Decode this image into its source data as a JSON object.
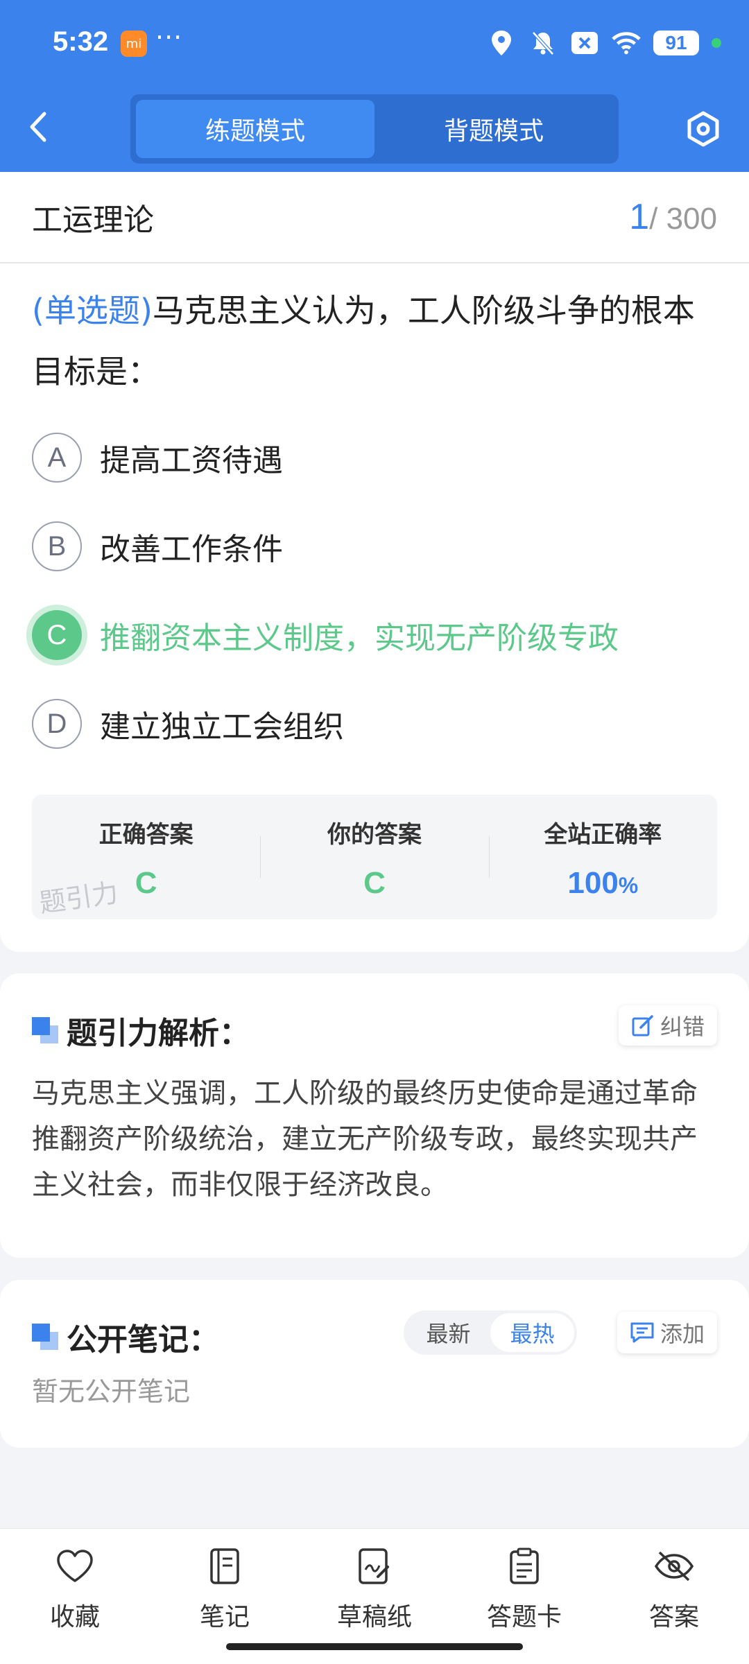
{
  "status_bar": {
    "time": "5:32",
    "app_badge": "mi",
    "more": "···",
    "battery": "91",
    "icons": [
      "location-icon",
      "bell-off-icon",
      "notification-x-icon",
      "wifi-icon"
    ]
  },
  "header": {
    "mode_tabs": [
      "练题模式",
      "背题模式"
    ],
    "active_mode": "练题模式"
  },
  "question": {
    "subject": "工运理论",
    "current": "1",
    "total": "/ 300",
    "type_label": "(单选题)",
    "text": "马克思主义认为，工人阶级斗争的根本目标是：",
    "options": [
      {
        "letter": "A",
        "text": "提高工资待遇"
      },
      {
        "letter": "B",
        "text": "改善工作条件"
      },
      {
        "letter": "C",
        "text": "推翻资本主义制度，实现无产阶级专政"
      },
      {
        "letter": "D",
        "text": "建立独立工会组织"
      }
    ]
  },
  "result": {
    "correct_label": "正确答案",
    "correct_value": "C",
    "yours_label": "你的答案",
    "yours_value": "C",
    "rate_label": "全站正确率",
    "rate_value": "100",
    "rate_unit": "%",
    "watermark": "题引力"
  },
  "analysis": {
    "title": "题引力解析：",
    "fix_label": "纠错",
    "text": "马克思主义强调，工人阶级的最终历史使命是通过革命推翻资产阶级统治，建立无产阶级专政，最终实现共产主义社会，而非仅限于经济改良。"
  },
  "notes": {
    "title": "公开笔记：",
    "sort_options": [
      "最新",
      "最热"
    ],
    "active_sort": "最热",
    "add_label": "添加",
    "empty_text": "暂无公开笔记"
  },
  "bottom_nav": [
    {
      "label": "收藏",
      "icon": "heart-icon"
    },
    {
      "label": "笔记",
      "icon": "notebook-icon"
    },
    {
      "label": "草稿纸",
      "icon": "draft-paper-icon"
    },
    {
      "label": "答题卡",
      "icon": "answer-sheet-icon"
    },
    {
      "label": "答案",
      "icon": "eye-off-icon"
    }
  ],
  "colors": {
    "primary": "#3b82ec",
    "correct": "#5cc98a"
  }
}
